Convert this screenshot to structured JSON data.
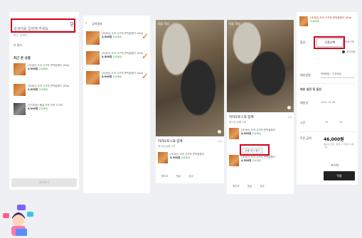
{
  "search": {
    "placeholder": "검색어를 입력해 주세요",
    "recent_label": "최근 검색어",
    "filter_label": "필터",
    "section_title": "최근 본 상품",
    "button_label": "검색하기"
  },
  "products": [
    {
      "name": "[국내산] 오곡 고구마 쫀득말랭이 160g",
      "price": "4,500원",
      "tag": "무료배송"
    },
    {
      "name": "[국내산] 오곡 고구마 쫀득말랭이 160g",
      "price": "4,500원",
      "tag": "무료배송"
    },
    {
      "name": "[산지직송] 햇살 가득 건조 고구마",
      "price": "8,900원",
      "tag": "무료배송"
    }
  ],
  "results": {
    "back_icon": "chevron-left-icon",
    "title": "검색결과",
    "items": [
      {
        "name": "[국내산] 오곡 고구마 쫀득말랭이 160g",
        "price": "4,500원",
        "tag": "무료배송"
      },
      {
        "name": "[국내산] 오곡 고구마 쫀득말랭이 160g",
        "price": "4,500원",
        "tag": "무료배송"
      },
      {
        "name": "[국내산] 오곡 고구마 쫀득말랭이 160g",
        "price": "6,900원",
        "tag": "무료배송"
      }
    ]
  },
  "post_a": {
    "top_caption": "리뷰 작성",
    "title": "카카오토스와 함께",
    "meta": "1/3",
    "sub": "태그된 상품 2개",
    "items": [
      {
        "name": "[국내산] 오곡 고구마 쫀득말랭이",
        "price": "4,500원",
        "tag": "무료배송"
      }
    ],
    "links": [
      "좋아요",
      "댓글",
      "공유"
    ]
  },
  "post_b": {
    "top_caption": "리뷰 작성",
    "title": "카카오토스와 함께",
    "meta": "1/3",
    "sub": "태그된 상품 2개",
    "items": [
      {
        "name": "[국내산] 오곡 고구마 쫀득말랭이",
        "price": "4,500원",
        "tag": "무료배송"
      },
      {
        "name": "[국내산] 오곡 고구마 쫀득말랭이",
        "price": "4,500원",
        "tag": "무료배송"
      }
    ],
    "link_button": "상품 링크 열기",
    "links": [
      "좋아요",
      "댓글",
      "공유"
    ]
  },
  "form": {
    "product_name": "[국내산] 오곡 고구마 쫀득말랭이 160g",
    "product_tag": "무료배송",
    "option_label": "옵션",
    "option_selected": "단품선택",
    "option_other": "묶음선택",
    "radio_label": "정기배송",
    "delivery_label": "배송방법",
    "delivery_value": "택배배송 · 무료배송",
    "section_title": "배송 일정 및 옵션",
    "date_label": "배송일",
    "date_value": "2021.12.28",
    "time_label": "시간",
    "time_values": [
      "10",
      "30"
    ],
    "total_label": "주문 금액",
    "total_value": "46,000원",
    "total_note": "배송비 포함 · 결제 시 적립금 사용 가능",
    "reset_label": "초기화",
    "submit_label": "적용"
  },
  "colors": {
    "highlight": "#d0021b",
    "accent": "#e06a1a",
    "price_tag": "#4caf50"
  }
}
